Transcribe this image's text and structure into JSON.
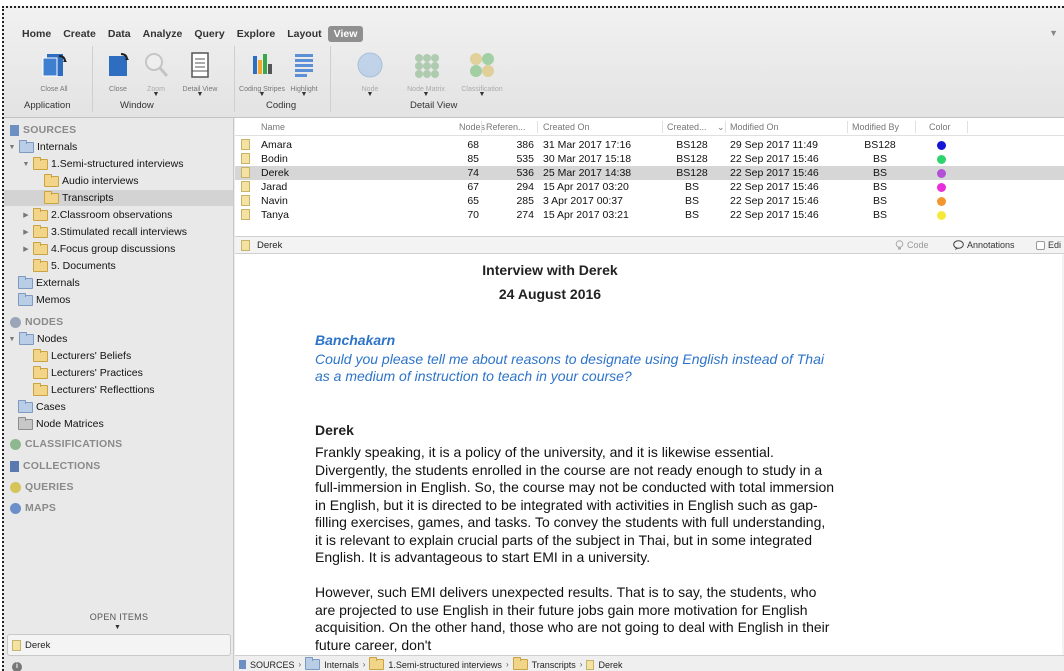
{
  "menu": {
    "tabs": [
      "Home",
      "Create",
      "Data",
      "Analyze",
      "Query",
      "Explore",
      "Layout",
      "View"
    ],
    "active": "View"
  },
  "ribbon": {
    "buttons": {
      "close_all": "Close All",
      "close": "Close",
      "zoom": "Zoom",
      "detail_view": "Detail View",
      "coding_stripes": "Coding Stripes",
      "highlight": "Highlight",
      "node": "Node",
      "node_matrix": "Node Matrix",
      "classification": "Classification"
    },
    "groups": {
      "application": "Application",
      "window": "Window",
      "coding": "Coding",
      "detail_view": "Detail View"
    }
  },
  "sidebar": {
    "sources": "SOURCES",
    "internals": "Internals",
    "semi": "1.Semi-structured interviews",
    "audio": "Audio interviews",
    "transcripts": "Transcripts",
    "classroom": "2.Classroom observations",
    "stimulated": "3.Stimulated recall interviews",
    "focus": "4.Focus group discussions",
    "documents": "5. Documents",
    "externals": "Externals",
    "memos": "Memos",
    "nodes_head": "NODES",
    "nodes": "Nodes",
    "beliefs": "Lecturers' Beliefs",
    "practices": "Lecturers' Practices",
    "reflections": "Lecturers' Reflecttions",
    "cases": "Cases",
    "node_matrices": "Node Matrices",
    "classifications": "CLASSIFICATIONS",
    "collections": "COLLECTIONS",
    "queries": "QUERIES",
    "maps": "MAPS",
    "open_items": "OPEN ITEMS",
    "open_doc": "Derek"
  },
  "list": {
    "headers": {
      "name": "Name",
      "nodes": "Nodes",
      "refs": "Referen...",
      "created_on": "Created On",
      "created_by": "Created...",
      "modified_on": "Modified On",
      "modified_by": "Modified By",
      "color": "Color"
    },
    "rows": [
      {
        "name": "Amara",
        "nodes": "68",
        "refs": "386",
        "created_on": "31 Mar 2017 17:16",
        "created_by": "BS128",
        "modified_on": "29 Sep 2017 11:49",
        "modified_by": "BS128",
        "color": "#1515d6"
      },
      {
        "name": "Bodin",
        "nodes": "85",
        "refs": "535",
        "created_on": "30 Mar 2017 15:18",
        "created_by": "BS128",
        "modified_on": "22 Sep 2017 15:46",
        "modified_by": "BS",
        "color": "#2fd36b"
      },
      {
        "name": "Derek",
        "nodes": "74",
        "refs": "536",
        "created_on": "25 Mar 2017 14:38",
        "created_by": "BS128",
        "modified_on": "22 Sep 2017 15:46",
        "modified_by": "BS",
        "color": "#b24fd6"
      },
      {
        "name": "Jarad",
        "nodes": "67",
        "refs": "294",
        "created_on": "15 Apr 2017 03:20",
        "created_by": "BS",
        "modified_on": "22 Sep 2017 15:46",
        "modified_by": "BS",
        "color": "#e82fd9"
      },
      {
        "name": "Navin",
        "nodes": "65",
        "refs": "285",
        "created_on": "3 Apr 2017 00:37",
        "created_by": "BS",
        "modified_on": "22 Sep 2017 15:46",
        "modified_by": "BS",
        "color": "#f2962f"
      },
      {
        "name": "Tanya",
        "nodes": "70",
        "refs": "274",
        "created_on": "15 Apr 2017 03:21",
        "created_by": "BS",
        "modified_on": "22 Sep 2017 15:46",
        "modified_by": "BS",
        "color": "#f5ea3a"
      }
    ]
  },
  "doc_bar": {
    "title": "Derek",
    "code": "Code",
    "annotations": "Annotations",
    "edit": "Edi"
  },
  "document": {
    "title": "Interview with Derek",
    "date": "24 August 2016",
    "q_speaker": "Banchakarn",
    "q_text": "Could you please tell me about reasons to designate using English instead of Thai as a medium of instruction to teach in your course?",
    "a_speaker": "Derek",
    "a_text1": "Frankly speaking, it is a policy of the university, and it is likewise essential. Divergently, the students enrolled in the course are not ready enough to study in a full-immersion in English. So, the course may not be conducted with total immersion in English, but it is directed to be integrated with activities in English such as gap-filling exercises, games, and tasks. To convey the students with full understanding, it is relevant to explain crucial parts of the subject in Thai, but in some integrated English. It is advantageous to start EMI in a university.",
    "a_text2": "However, such EMI delivers unexpected results. That is to say, the students, who are projected to use English in their future jobs gain more motivation for English acquisition. On the other hand, those who are not going to deal with English in their future career, don't"
  },
  "breadcrumb": {
    "sources": "SOURCES",
    "internals": "Internals",
    "semi": "1.Semi-structured interviews",
    "transcripts": "Transcripts",
    "derek": "Derek"
  }
}
